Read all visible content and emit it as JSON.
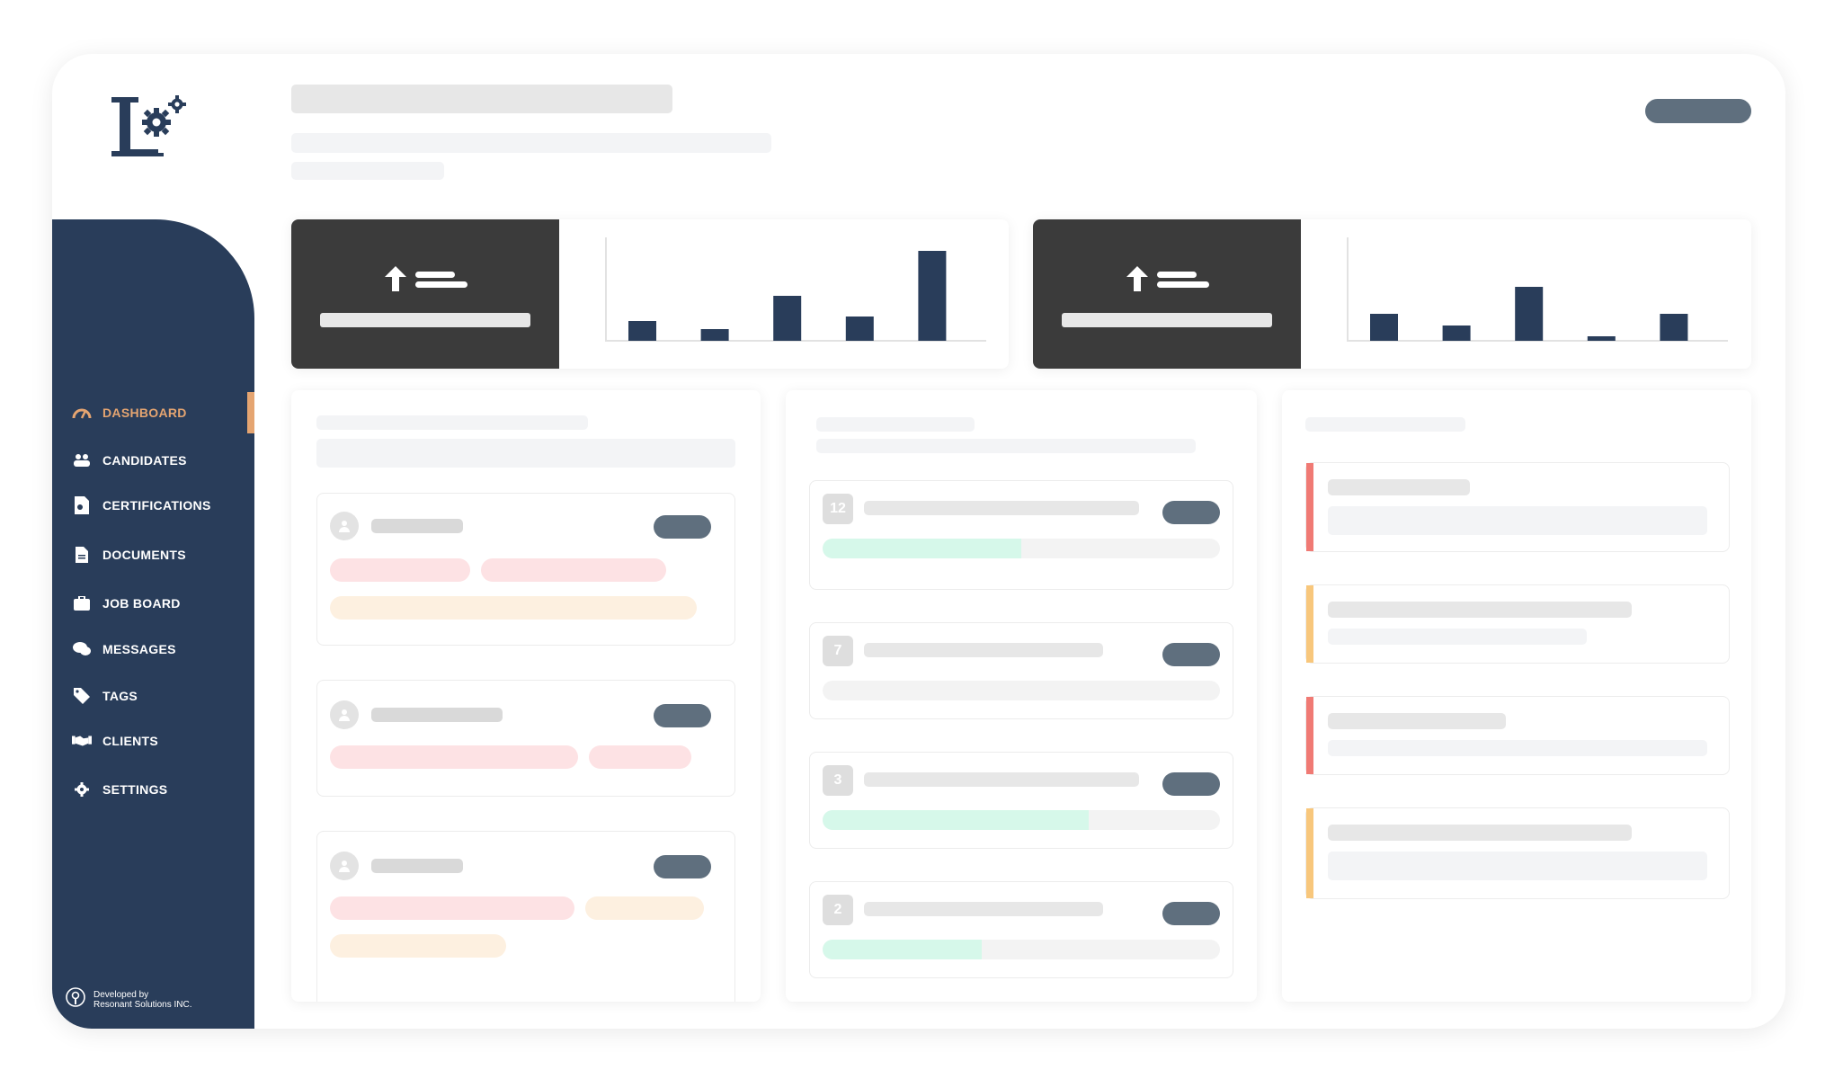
{
  "brand": {
    "logo_letter": "L",
    "color_primary": "#293d5a",
    "color_accent": "#e5a571"
  },
  "sidebar": {
    "items": [
      {
        "label": "DASHBOARD",
        "icon": "gauge-icon",
        "active": true
      },
      {
        "label": "CANDIDATES",
        "icon": "users-icon",
        "active": false
      },
      {
        "label": "CERTIFICATIONS",
        "icon": "certificate-icon",
        "active": false
      },
      {
        "label": "DOCUMENTS",
        "icon": "document-icon",
        "active": false
      },
      {
        "label": "JOB BOARD",
        "icon": "briefcase-icon",
        "active": false
      },
      {
        "label": "MESSAGES",
        "icon": "chat-icon",
        "active": false
      },
      {
        "label": "TAGS",
        "icon": "tag-icon",
        "active": false
      },
      {
        "label": "CLIENTS",
        "icon": "handshake-icon",
        "active": false
      },
      {
        "label": "SETTINGS",
        "icon": "gear-icon",
        "active": false
      }
    ],
    "footer": {
      "line1": "Developed by",
      "line2": "Resonant Solutions INC."
    }
  },
  "stat_cards": [
    {
      "icon": "arrow-up-list-icon",
      "chart_data": {
        "type": "bar",
        "values": [
          0.22,
          0.13,
          0.5,
          0.27,
          1.0
        ]
      }
    },
    {
      "icon": "arrow-up-list-icon",
      "chart_data": {
        "type": "bar",
        "values": [
          0.3,
          0.17,
          0.6,
          0.05,
          0.3
        ]
      }
    }
  ],
  "queue": {
    "items": [
      {
        "count": "12",
        "progress": 0.5
      },
      {
        "count": "7",
        "progress": 0
      },
      {
        "count": "3",
        "progress": 0.67
      },
      {
        "count": "2",
        "progress": 0.4
      }
    ]
  },
  "alerts": {
    "colors": {
      "red": "#f07a74",
      "yellow": "#f8c77c"
    },
    "items": [
      {
        "level": "red"
      },
      {
        "level": "yellow"
      },
      {
        "level": "red"
      },
      {
        "level": "yellow"
      }
    ]
  }
}
